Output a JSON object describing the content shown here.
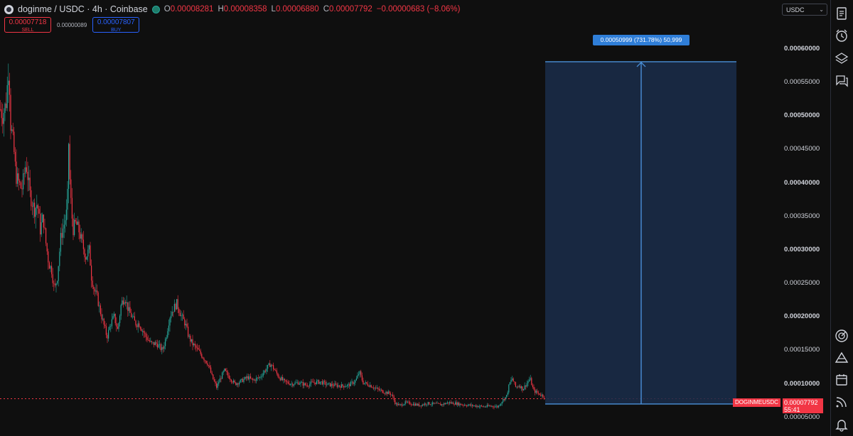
{
  "header": {
    "title": "doginme / USDC · 4h · Coinbase",
    "ohlc": {
      "o_label": "O",
      "o": "0.00008281",
      "h_label": "H",
      "h": "0.00008358",
      "l_label": "L",
      "l": "0.00006880",
      "c_label": "C",
      "c": "0.00007792",
      "change": "−0.00000683 (−8.06%)"
    }
  },
  "trade": {
    "sell_price": "0.00007718",
    "sell_label": "SELL",
    "spread": "0.00000089",
    "buy_price": "0.00007807",
    "buy_label": "BUY"
  },
  "currency_select": {
    "value": "USDC"
  },
  "measure": {
    "label": "0.00050999 (731.78%) 50,999",
    "from_price": 7e-05,
    "to_price": 0.000581
  },
  "last_price": {
    "symbol": "DOGINMEUSDC",
    "price": "0.00007792",
    "countdown": "55:41",
    "value": 7.792e-05
  },
  "colors": {
    "up": "#26a69a",
    "down": "#f23645",
    "measure_fill": "#1a2d4a",
    "measure_line": "#4a90d9",
    "label_bg": "#2f7ed8"
  },
  "right_toolbar": [
    "watchlist-icon",
    "alert-clock-icon",
    "layers-icon",
    "chat-icon",
    "target-icon",
    "triangle-icon",
    "calendar-icon",
    "signal-icon",
    "bell-icon"
  ],
  "chart_data": {
    "type": "candlestick",
    "title": "doginme / USDC · 4h · Coinbase",
    "y_ticks": [
      "0.00060000",
      "0.00055000",
      "0.00050000",
      "0.00045000",
      "0.00040000",
      "0.00035000",
      "0.00030000",
      "0.00025000",
      "0.00020000",
      "0.00015000",
      "0.00010000",
      "0.00005000"
    ],
    "y_tick_values": [
      0.0006,
      0.00055,
      0.0005,
      0.00045,
      0.0004,
      0.00035,
      0.0003,
      0.00025,
      0.0002,
      0.00015,
      0.0001,
      5e-05
    ],
    "y_bold_ticks": [
      0.0006,
      0.0005,
      0.0004,
      0.0003,
      0.0002,
      0.0001
    ],
    "ylim": [
      4.34e-05,
      0.000618
    ],
    "price_path": [
      [
        0,
        0.00051
      ],
      [
        3,
        0.0005
      ],
      [
        8,
        0.00052
      ],
      [
        12,
        0.00058
      ],
      [
        14,
        0.00049
      ],
      [
        18,
        0.00046
      ],
      [
        22,
        0.00041
      ],
      [
        30,
        0.00039
      ],
      [
        36,
        0.00043
      ],
      [
        42,
        0.00038
      ],
      [
        48,
        0.00036
      ],
      [
        52,
        0.00037
      ],
      [
        56,
        0.00033
      ],
      [
        60,
        0.00035
      ],
      [
        64,
        0.00031
      ],
      [
        68,
        0.00028
      ],
      [
        72,
        0.00027
      ],
      [
        76,
        0.00024
      ],
      [
        80,
        0.00026
      ],
      [
        85,
        0.00032
      ],
      [
        90,
        0.00034
      ],
      [
        94,
        0.00036
      ],
      [
        96,
        0.00046
      ],
      [
        98,
        0.00039
      ],
      [
        102,
        0.00033
      ],
      [
        106,
        0.00034
      ],
      [
        110,
        0.00033
      ],
      [
        115,
        0.00031
      ],
      [
        120,
        0.00029
      ],
      [
        125,
        0.0003
      ],
      [
        128,
        0.00026
      ],
      [
        132,
        0.00024
      ],
      [
        136,
        0.00023
      ],
      [
        140,
        0.00021
      ],
      [
        145,
        0.00019
      ],
      [
        150,
        0.00017
      ],
      [
        155,
        0.00019
      ],
      [
        160,
        0.0002
      ],
      [
        165,
        0.00018
      ],
      [
        170,
        0.00022
      ],
      [
        175,
        0.00023
      ],
      [
        180,
        0.00021
      ],
      [
        185,
        0.0002
      ],
      [
        190,
        0.00019
      ],
      [
        195,
        0.00019
      ],
      [
        200,
        0.00018
      ],
      [
        205,
        0.00017
      ],
      [
        212,
        0.00016
      ],
      [
        220,
        0.00016
      ],
      [
        228,
        0.00015
      ],
      [
        233,
        0.00017
      ],
      [
        238,
        0.0002
      ],
      [
        242,
        0.00021
      ],
      [
        248,
        0.00022
      ],
      [
        255,
        0.0002
      ],
      [
        260,
        0.00019
      ],
      [
        265,
        0.00017
      ],
      [
        270,
        0.00016
      ],
      [
        278,
        0.00015
      ],
      [
        285,
        0.00014
      ],
      [
        292,
        0.00013
      ],
      [
        298,
        0.00011
      ],
      [
        304,
        9.5e-05
      ],
      [
        308,
        0.000105
      ],
      [
        315,
        0.00012
      ],
      [
        322,
        0.00011
      ],
      [
        330,
        0.0001
      ],
      [
        340,
        0.000105
      ],
      [
        348,
        0.00011
      ],
      [
        355,
        0.000105
      ],
      [
        365,
        0.00011
      ],
      [
        372,
        0.00012
      ],
      [
        380,
        0.00013
      ],
      [
        386,
        0.00012
      ],
      [
        392,
        0.00011
      ],
      [
        400,
        0.000103
      ],
      [
        410,
        0.0001
      ],
      [
        420,
        0.000102
      ],
      [
        430,
        9.8e-05
      ],
      [
        440,
        0.000102
      ],
      [
        450,
        0.000103
      ],
      [
        460,
        9.9e-05
      ],
      [
        470,
        9.8e-05
      ],
      [
        480,
        9.7e-05
      ],
      [
        490,
        9.8e-05
      ],
      [
        500,
        0.000105
      ],
      [
        505,
        0.000118
      ],
      [
        510,
        0.000102
      ],
      [
        520,
        9.8e-05
      ],
      [
        530,
        9.2e-05
      ],
      [
        540,
        8.8e-05
      ],
      [
        550,
        8.5e-05
      ],
      [
        556,
        7e-05
      ],
      [
        562,
        6.8e-05
      ],
      [
        570,
        7.2e-05
      ],
      [
        580,
        7e-05
      ],
      [
        590,
        6.8e-05
      ],
      [
        600,
        7.1e-05
      ],
      [
        610,
        7e-05
      ],
      [
        620,
        6.9e-05
      ],
      [
        630,
        7.2e-05
      ],
      [
        640,
        7.1e-05
      ],
      [
        650,
        6.9e-05
      ],
      [
        660,
        6.8e-05
      ],
      [
        670,
        6.7e-05
      ],
      [
        680,
        6.6e-05
      ],
      [
        690,
        6.7e-05
      ],
      [
        700,
        6.6e-05
      ],
      [
        706,
        7.5e-05
      ],
      [
        712,
        8.2e-05
      ],
      [
        716,
        0.0001
      ],
      [
        720,
        0.000108
      ],
      [
        725,
        9.5e-05
      ],
      [
        730,
        9.8e-05
      ],
      [
        735,
        9.2e-05
      ],
      [
        740,
        0.0001
      ],
      [
        745,
        0.000108
      ],
      [
        750,
        9e-05
      ],
      [
        758,
        8.5e-05
      ],
      [
        766,
        8.1e-05
      ]
    ]
  }
}
